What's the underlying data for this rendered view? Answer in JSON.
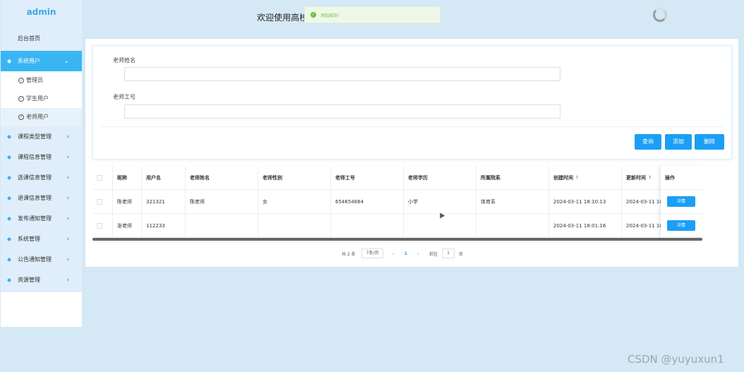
{
  "sidebar": {
    "brand": "admin",
    "home": "后台首页",
    "active_group": {
      "label": "系统用户",
      "arrow": "⌄"
    },
    "sub_items": [
      {
        "label": "管理员"
      },
      {
        "label": "学生用户"
      },
      {
        "label": "老师用户"
      }
    ],
    "groups": [
      {
        "label": "课程类型管理"
      },
      {
        "label": "课程信息管理"
      },
      {
        "label": "选课信息管理"
      },
      {
        "label": "退课信息管理"
      },
      {
        "label": "发布通知管理"
      },
      {
        "label": "系统管理"
      },
      {
        "label": "公告通知管理"
      },
      {
        "label": "资源管理"
      }
    ]
  },
  "header": {
    "welcome": "欢迎使用高校",
    "toast": "添加成功!"
  },
  "search": {
    "teacher_name_label": "老师姓名",
    "teacher_name_value": "",
    "teacher_id_label": "老师工号",
    "teacher_id_value": "",
    "query_btn": "查询",
    "add_btn": "添加",
    "delete_btn": "删除"
  },
  "table": {
    "headers": [
      "昵称",
      "用户名",
      "老师姓名",
      "老师性别",
      "老师工号",
      "老师学历",
      "所属院系",
      "创建时间",
      "更新时间"
    ],
    "op_header": "操作",
    "rows": [
      [
        "陈老师",
        "321321",
        "陈老师",
        "女",
        "654654684",
        "小学",
        "体育系",
        "2024-03-11 18:10:13",
        "2024-03-11 18:1"
      ],
      [
        "张老师",
        "112233",
        "",
        "",
        "",
        "",
        "",
        "2024-03-11 18:01:16",
        "2024-03-11 18:0"
      ]
    ],
    "detail_btn": "详情"
  },
  "pager": {
    "total": "共 2 条",
    "page_size": "7条/页",
    "prev": "‹",
    "current": "1",
    "next": "›",
    "goto_prefix": "前往",
    "goto_value": "1",
    "goto_suffix": "页"
  },
  "watermark": "CSDN @yuyuxun1"
}
